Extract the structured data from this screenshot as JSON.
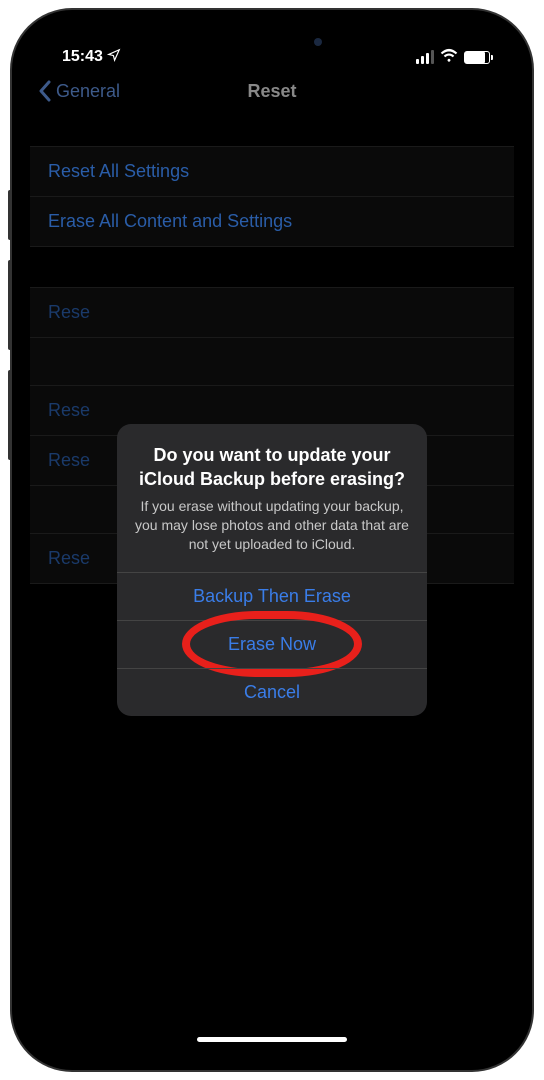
{
  "statusBar": {
    "time": "15:43",
    "locationActive": true
  },
  "nav": {
    "backLabel": "General",
    "title": "Reset"
  },
  "groups": [
    {
      "items": [
        "Reset All Settings",
        "Erase All Content and Settings"
      ]
    },
    {
      "items": [
        "Rese",
        "",
        "Rese",
        "Rese",
        "",
        "Rese"
      ]
    }
  ],
  "alert": {
    "title": "Do you want to update your iCloud Backup before erasing?",
    "message": "If you erase without updating your backup, you may lose photos and other data that are not yet uploaded to iCloud.",
    "buttons": {
      "backup": "Backup Then Erase",
      "erase": "Erase Now",
      "cancel": "Cancel"
    }
  },
  "highlightTarget": "erase"
}
